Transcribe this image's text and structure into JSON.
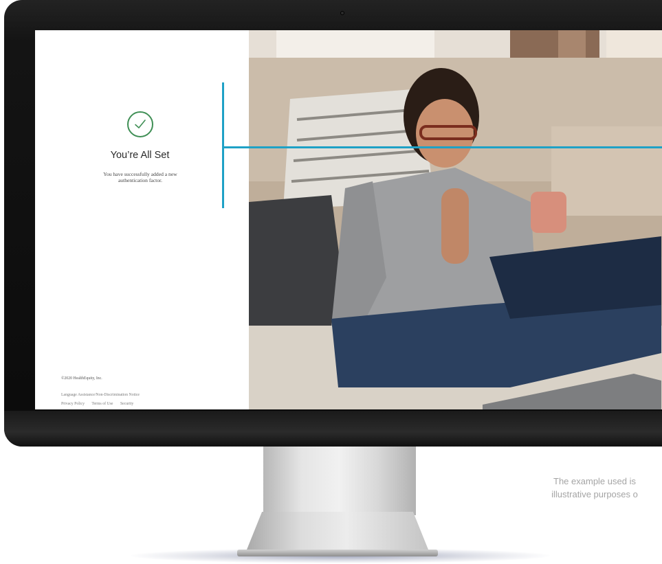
{
  "screen": {
    "confirmation": {
      "icon": "check-icon",
      "accent_color": "#3f8f55",
      "title": "You’re All Set",
      "message": "You have successfully added a new authentication factor."
    },
    "footer": {
      "copyright": "©2020 HealthEquity, Inc.",
      "links": {
        "language_assistance": "Language Assistance/Non-Discrimination Notice",
        "privacy_policy": "Privacy Policy",
        "terms_of_use": "Terms of Use",
        "security": "Security"
      }
    }
  },
  "callout_color": "#1ea1c6",
  "disclaimer": {
    "line1": "The example used is",
    "line2": "illustrative purposes o"
  }
}
